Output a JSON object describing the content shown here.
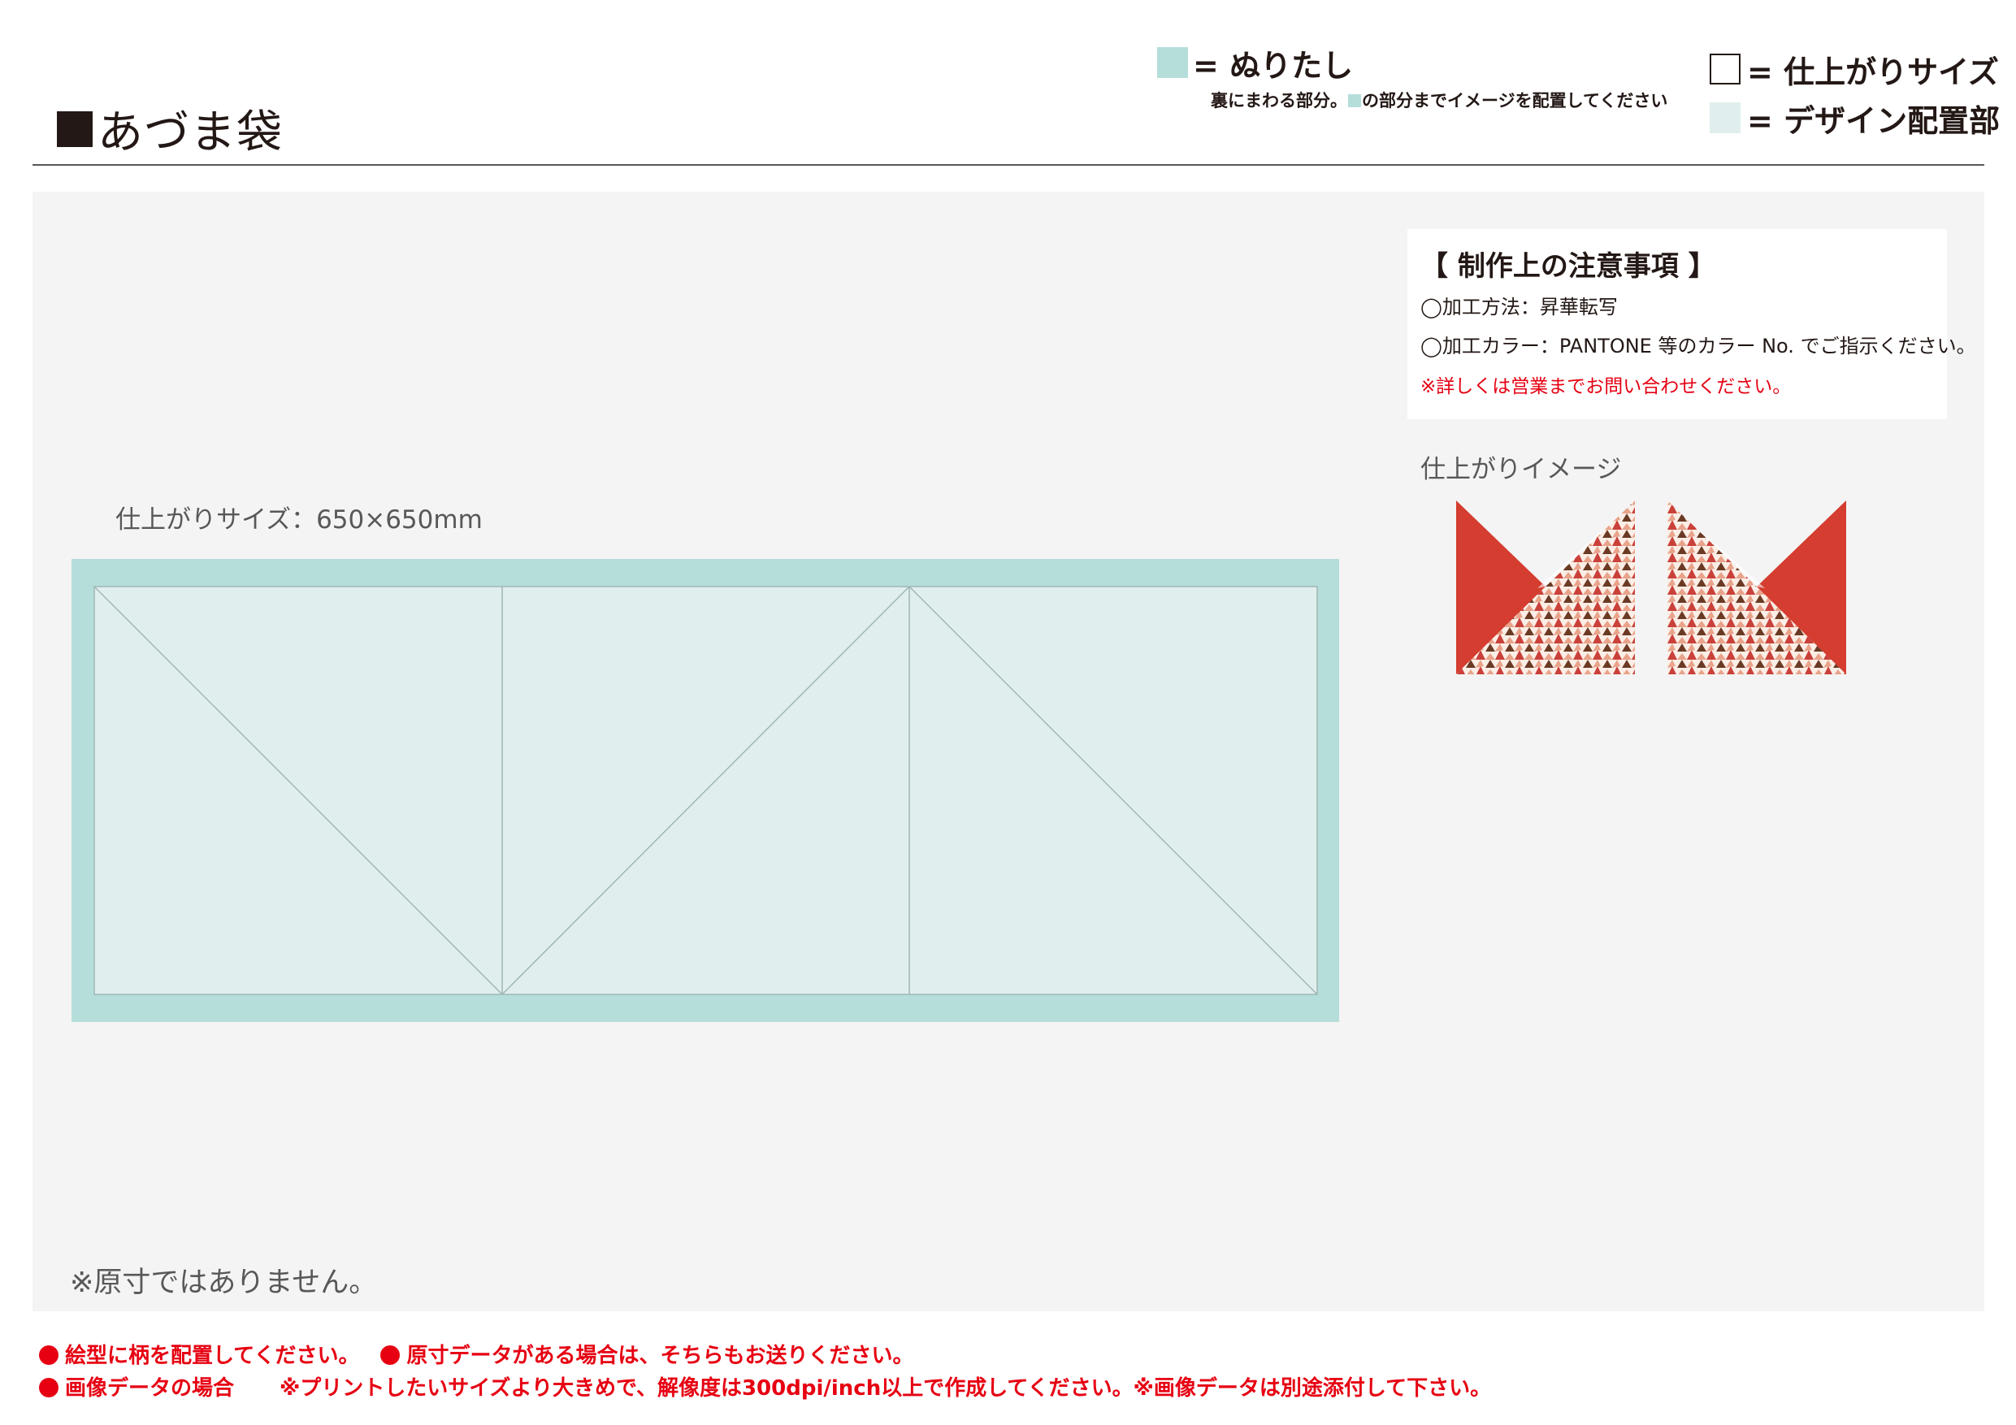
{
  "header": {
    "title": "あづま袋"
  },
  "legend": {
    "bleed_label": "= ぬりたし",
    "bleed_note_before": "裏にまわる部分。",
    "bleed_note_after": "の部分までイメージを配置してください",
    "finish_label": "= 仕上がりサイズ",
    "design_label": "= デザイン配置部",
    "colors": {
      "bleed": "#b5dedb",
      "design": "#e0efed",
      "finish_border": "#231815"
    }
  },
  "template": {
    "finish_size_label": "仕上がりサイズ：650×650mm",
    "not_actual_size": "※原寸ではありません。"
  },
  "notes": {
    "title": "【 制作上の注意事項 】",
    "method": "◯加工方法：昇華転写",
    "color": "◯加工カラー：PANTONE 等のカラー No. でご指示ください。",
    "contact": "※詳しくは営業までお問い合わせください。"
  },
  "preview": {
    "label": "仕上がりイメージ",
    "colors": {
      "solid": "#d43d2f",
      "pattern_base": "#fbeee6",
      "pattern_a": "#c9413a",
      "pattern_b": "#6b3a24",
      "pattern_c": "#e8a38a"
    }
  },
  "footer": {
    "line1_a": "絵型に柄を配置してください。",
    "line1_b": "原寸データがある場合は、そちらもお送りください。",
    "line2_a": "画像データの場合",
    "line2_b": "※プリントしたいサイズより大きめで、解像度は300dpi/inch以上で作成してください。※画像データは別途添付して下さい。"
  }
}
